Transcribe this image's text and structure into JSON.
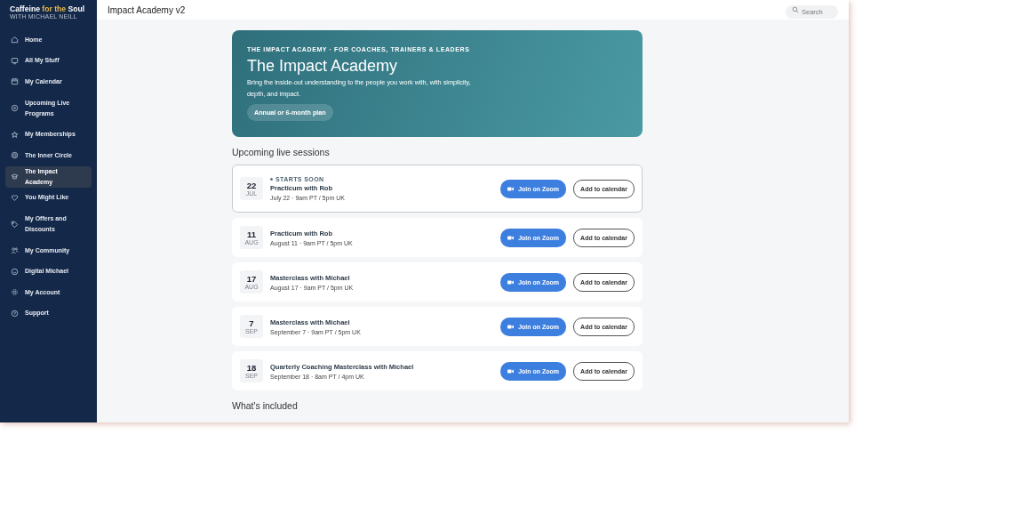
{
  "brand": {
    "title": [
      {
        "text": "Caffeine ",
        "highlight": false
      },
      {
        "text": "for the",
        "highlight": true
      },
      {
        "text": " Soul",
        "highlight": false
      }
    ],
    "subtitle": "WITH MICHAEL NEILL"
  },
  "sidebar": {
    "items": [
      {
        "label": "Home",
        "kind": "home",
        "selected": false
      },
      {
        "label": "All My Stuff",
        "kind": "screen",
        "selected": false
      },
      {
        "label": "My Calendar",
        "kind": "calendar",
        "selected": false
      },
      {
        "label": "Upcoming Live Programs",
        "kind": "live",
        "selected": false
      },
      {
        "label": "My Memberships",
        "kind": "star",
        "selected": false
      },
      {
        "label": "The Inner Circle",
        "kind": "target",
        "selected": false
      },
      {
        "label": "The Impact Academy",
        "kind": "cap",
        "selected": true
      },
      {
        "label": "You Might Like",
        "kind": "heart",
        "selected": false
      },
      {
        "label": "My Offers and Discounts",
        "kind": "tag",
        "selected": false
      },
      {
        "label": "My Community",
        "kind": "people",
        "selected": false
      },
      {
        "label": "Digital Michael",
        "kind": "smile",
        "selected": false
      },
      {
        "label": "My Account",
        "kind": "gear",
        "selected": false
      },
      {
        "label": "Support",
        "kind": "help",
        "selected": false
      }
    ]
  },
  "header": {
    "title": "Impact Academy v2",
    "search": {
      "placeholder": "Search"
    }
  },
  "hero": {
    "eyebrow": "THE IMPACT ACADEMY · FOR COACHES, TRAINERS & LEADERS",
    "title": "The Impact Academy",
    "text": "Bring the inside-out understanding to the people you work with, with simplicity, depth, and impact.",
    "button": "Annual or 6-month plan"
  },
  "sessions_heading": "Upcoming live sessions",
  "sessions": [
    {
      "day": "22",
      "month": "JUL",
      "badge": "STARTS SOON",
      "highlighted": true,
      "title": "Practicum with Rob",
      "time": "July 22 · 9am PT / 5pm UK",
      "join": "Join on Zoom",
      "calendar": "Add to calendar"
    },
    {
      "day": "11",
      "month": "AUG",
      "highlighted": false,
      "title": "Practicum with Rob",
      "time": "August 11 · 9am PT / 5pm UK",
      "join": "Join on Zoom",
      "calendar": "Add to calendar"
    },
    {
      "day": "17",
      "month": "AUG",
      "highlighted": false,
      "title": "Masterclass with Michael",
      "time": "August 17 · 9am PT / 5pm UK",
      "join": "Join on Zoom",
      "calendar": "Add to calendar"
    },
    {
      "day": "7",
      "month": "SEP",
      "highlighted": false,
      "title": "Masterclass with Michael",
      "time": "September 7 · 9am PT / 5pm UK",
      "join": "Join on Zoom",
      "calendar": "Add to calendar"
    },
    {
      "day": "18",
      "month": "SEP",
      "highlighted": false,
      "title": "Quarterly Coaching Masterclass with Michael",
      "time": "September 18 · 8am PT / 4pm UK",
      "join": "Join on Zoom",
      "calendar": "Add to calendar"
    }
  ],
  "included_heading": "What's included"
}
